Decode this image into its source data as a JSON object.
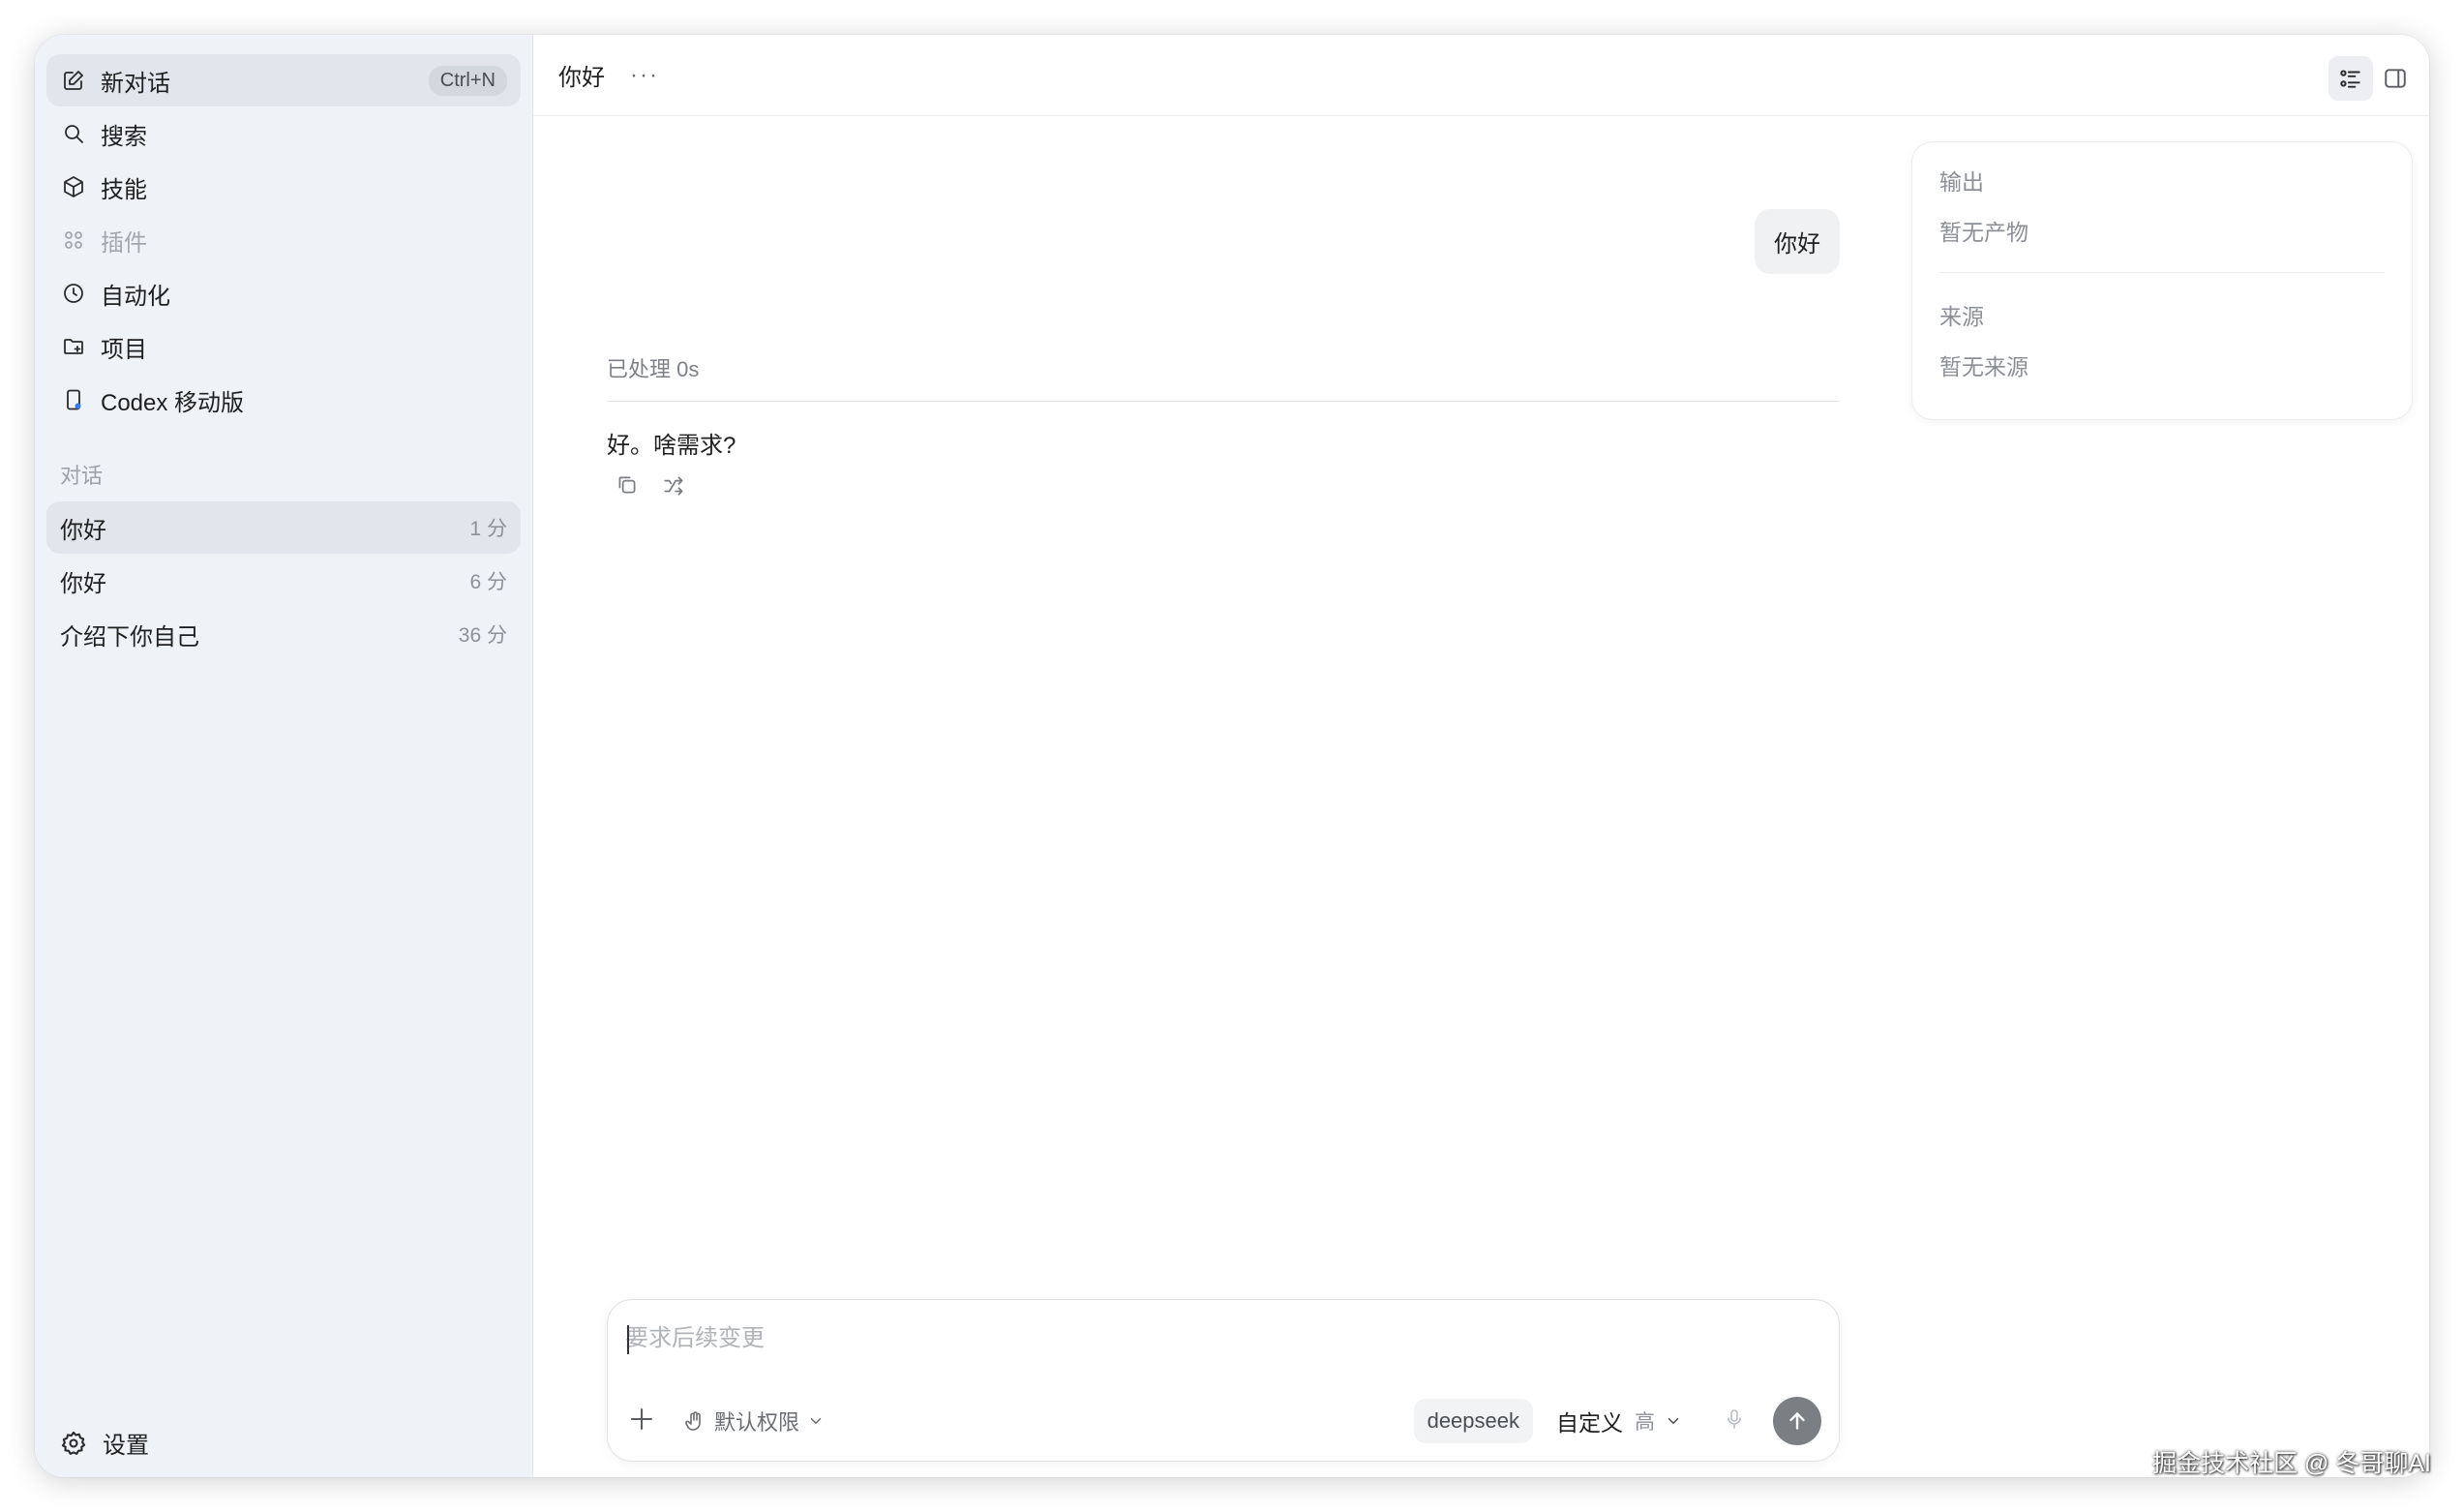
{
  "sidebar": {
    "nav": [
      {
        "label": "新对话",
        "shortcut": "Ctrl+N",
        "icon": "edit-icon"
      },
      {
        "label": "搜索",
        "icon": "search-icon"
      },
      {
        "label": "技能",
        "icon": "cube-icon"
      },
      {
        "label": "插件",
        "icon": "grid-icon"
      },
      {
        "label": "自动化",
        "icon": "clock-icon"
      },
      {
        "label": "项目",
        "icon": "folder-icon"
      },
      {
        "label": "Codex 移动版",
        "icon": "phone-icon"
      }
    ],
    "section_title": "对话",
    "conversations": [
      {
        "title": "你好",
        "time": "1 分"
      },
      {
        "title": "你好",
        "time": "6 分"
      },
      {
        "title": "介绍下你自己",
        "time": "36 分"
      }
    ],
    "settings_label": "设置"
  },
  "topbar": {
    "title": "你好",
    "more": "···"
  },
  "chat": {
    "user_message": "你好",
    "processed": "已处理 0s",
    "assistant_message": "好。啥需求?"
  },
  "panel": {
    "output_title": "输出",
    "output_empty": "暂无产物",
    "source_title": "来源",
    "source_empty": "暂无来源"
  },
  "composer": {
    "placeholder": "要求后续变更",
    "permission": "默认权限",
    "model": "deepseek",
    "mode": "自定义",
    "level": "高"
  },
  "watermark": "掘金技术社区 @ 冬哥聊AI",
  "colors": {
    "sidebar_bg": "#eff2f7",
    "active_item": "#e2e6ec",
    "send_button": "#7b7e83"
  }
}
